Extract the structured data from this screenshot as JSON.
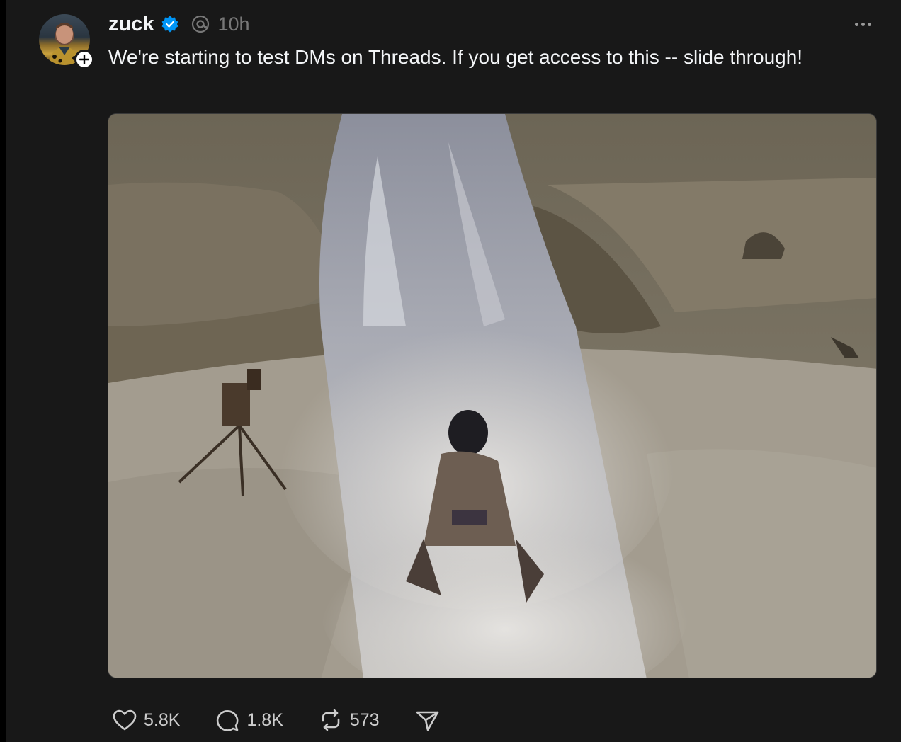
{
  "post": {
    "username": "zuck",
    "time": "10h",
    "text": "We're starting to test DMs on Threads. If you get access to this -- slide through!",
    "media": {
      "kind": "video-frame"
    },
    "stats": {
      "likes": "5.8K",
      "replies": "1.8K",
      "reposts": "573"
    }
  },
  "icons": {
    "verified": "verified-badge-icon",
    "threads": "threads-logo-icon",
    "more": "more-options-icon",
    "like": "heart-icon",
    "reply": "comment-icon",
    "repost": "repost-icon",
    "share": "send-icon"
  },
  "colors": {
    "background": "#181818",
    "text": "#f3f5f7",
    "muted": "#777777",
    "verified": "#0095f6"
  }
}
